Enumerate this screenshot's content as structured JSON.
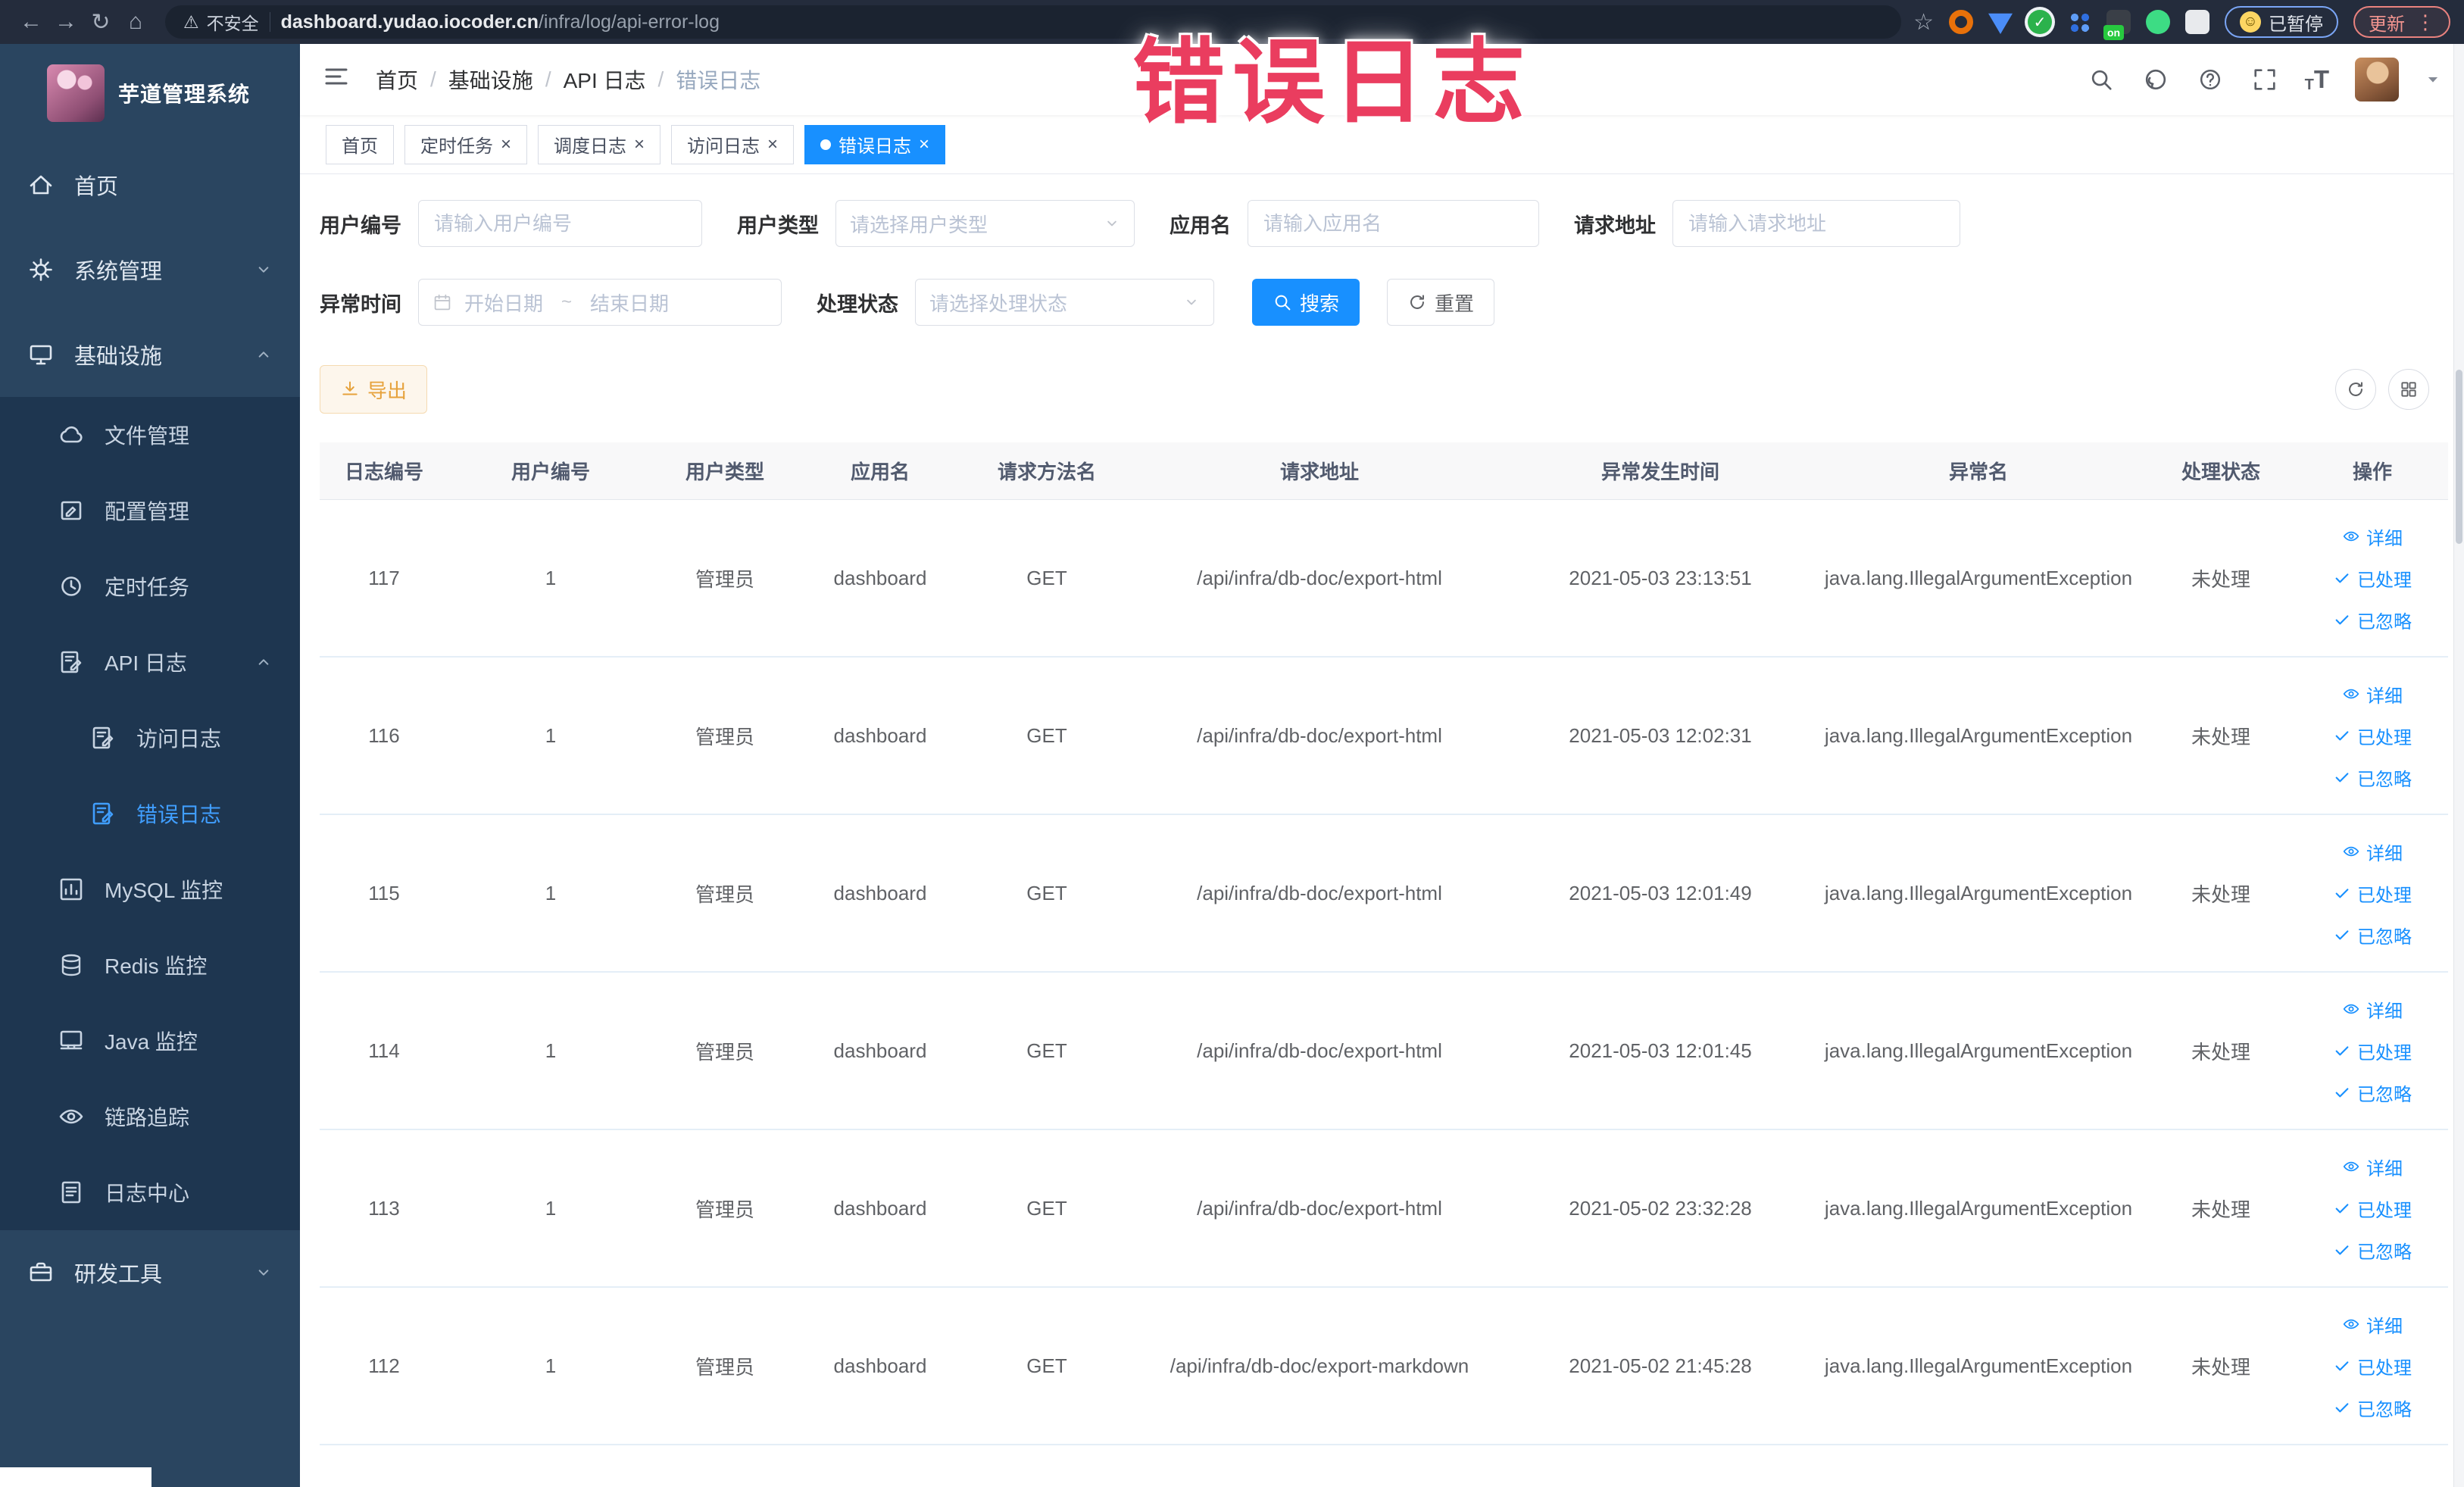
{
  "browser": {
    "security_label": "不安全",
    "url_domain": "dashboard.yudao.iocoder.cn",
    "url_path": "/infra/log/api-error-log",
    "paused_label": "已暂停",
    "update_label": "更新"
  },
  "overlay_title": "错误日志",
  "colors": {
    "primary": "#1890ff",
    "sidebar_bg": "#2a4560",
    "sidebar_sub_bg": "#1e3650",
    "active_menu": "#409eff",
    "warning": "#e6a23c",
    "overlay_red": "#ea3d5f"
  },
  "sidebar": {
    "app_title": "芋道管理系统",
    "items": [
      {
        "label": "首页",
        "icon": "home",
        "level": 1
      },
      {
        "label": "系统管理",
        "icon": "gear",
        "level": 1,
        "chevron": "down"
      },
      {
        "label": "基础设施",
        "icon": "monitor",
        "level": 1,
        "chevron": "up"
      },
      {
        "label": "文件管理",
        "icon": "cloud",
        "level": 2,
        "sub": true
      },
      {
        "label": "配置管理",
        "icon": "config",
        "level": 2,
        "sub": true
      },
      {
        "label": "定时任务",
        "icon": "clock",
        "level": 2,
        "sub": true
      },
      {
        "label": "API 日志",
        "icon": "docedit",
        "level": 2,
        "sub": true,
        "chevron": "up"
      },
      {
        "label": "访问日志",
        "icon": "docedit",
        "level": 3,
        "sub": true
      },
      {
        "label": "错误日志",
        "icon": "docedit",
        "level": 3,
        "sub": true,
        "active": true
      },
      {
        "label": "MySQL 监控",
        "icon": "chart",
        "level": 2,
        "sub": true
      },
      {
        "label": "Redis 监控",
        "icon": "layers",
        "level": 2,
        "sub": true
      },
      {
        "label": "Java 监控",
        "icon": "display",
        "level": 2,
        "sub": true
      },
      {
        "label": "链路追踪",
        "icon": "eye",
        "level": 2,
        "sub": true
      },
      {
        "label": "日志中心",
        "icon": "doc",
        "level": 2,
        "sub": true
      },
      {
        "label": "研发工具",
        "icon": "briefcase",
        "level": 1,
        "chevron": "down"
      }
    ]
  },
  "navbar": {
    "breadcrumbs": [
      "首页",
      "基础设施",
      "API 日志",
      "错误日志"
    ]
  },
  "tags": [
    {
      "label": "首页",
      "closable": false,
      "active": false
    },
    {
      "label": "定时任务",
      "closable": true,
      "active": false
    },
    {
      "label": "调度日志",
      "closable": true,
      "active": false
    },
    {
      "label": "访问日志",
      "closable": true,
      "active": false
    },
    {
      "label": "错误日志",
      "closable": true,
      "active": true
    }
  ],
  "filters": {
    "user_id": {
      "label": "用户编号",
      "placeholder": "请输入用户编号"
    },
    "user_type": {
      "label": "用户类型",
      "placeholder": "请选择用户类型"
    },
    "app_name": {
      "label": "应用名",
      "placeholder": "请输入应用名"
    },
    "request_url": {
      "label": "请求地址",
      "placeholder": "请输入请求地址"
    },
    "exception_time": {
      "label": "异常时间",
      "start_placeholder": "开始日期",
      "separator": "~",
      "end_placeholder": "结束日期"
    },
    "process_status": {
      "label": "处理状态",
      "placeholder": "请选择处理状态"
    },
    "search_label": "搜索",
    "reset_label": "重置"
  },
  "toolbar": {
    "export_label": "导出"
  },
  "table": {
    "columns": [
      "日志编号",
      "用户编号",
      "用户类型",
      "应用名",
      "请求方法名",
      "请求地址",
      "异常发生时间",
      "异常名",
      "处理状态",
      "操作"
    ],
    "action_labels": [
      "详细",
      "已处理",
      "已忽略"
    ],
    "rows": [
      {
        "id": "117",
        "user_id": "1",
        "user_type": "管理员",
        "app_name": "dashboard",
        "method": "GET",
        "url": "/api/infra/db-doc/export-html",
        "time": "2021-05-03 23:13:51",
        "exception": "java.lang.IllegalArgumentException",
        "status": "未处理"
      },
      {
        "id": "116",
        "user_id": "1",
        "user_type": "管理员",
        "app_name": "dashboard",
        "method": "GET",
        "url": "/api/infra/db-doc/export-html",
        "time": "2021-05-03 12:02:31",
        "exception": "java.lang.IllegalArgumentException",
        "status": "未处理"
      },
      {
        "id": "115",
        "user_id": "1",
        "user_type": "管理员",
        "app_name": "dashboard",
        "method": "GET",
        "url": "/api/infra/db-doc/export-html",
        "time": "2021-05-03 12:01:49",
        "exception": "java.lang.IllegalArgumentException",
        "status": "未处理"
      },
      {
        "id": "114",
        "user_id": "1",
        "user_type": "管理员",
        "app_name": "dashboard",
        "method": "GET",
        "url": "/api/infra/db-doc/export-html",
        "time": "2021-05-03 12:01:45",
        "exception": "java.lang.IllegalArgumentException",
        "status": "未处理"
      },
      {
        "id": "113",
        "user_id": "1",
        "user_type": "管理员",
        "app_name": "dashboard",
        "method": "GET",
        "url": "/api/infra/db-doc/export-html",
        "time": "2021-05-02 23:32:28",
        "exception": "java.lang.IllegalArgumentException",
        "status": "未处理"
      },
      {
        "id": "112",
        "user_id": "1",
        "user_type": "管理员",
        "app_name": "dashboard",
        "method": "GET",
        "url": "/api/infra/db-doc/export-markdown",
        "time": "2021-05-02 21:45:28",
        "exception": "java.lang.IllegalArgumentException",
        "status": "未处理"
      }
    ]
  }
}
